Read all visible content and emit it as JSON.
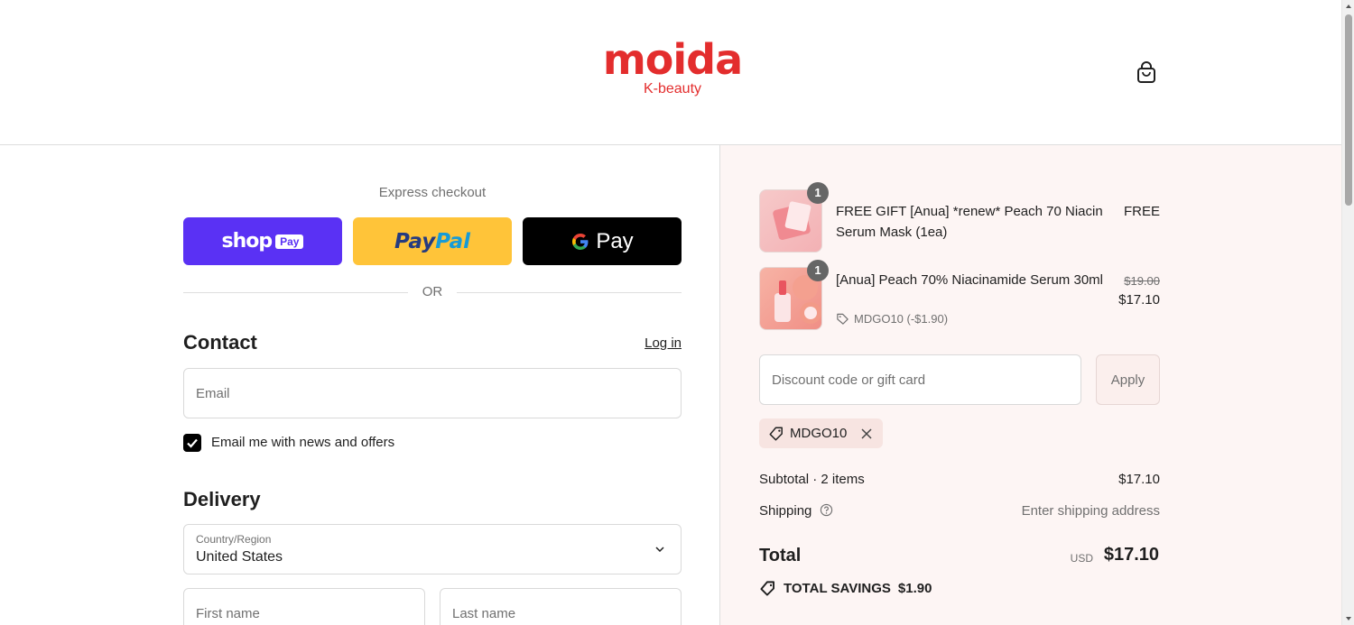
{
  "brand": {
    "name": "moida",
    "tagline": "K-beauty"
  },
  "header": {
    "cart_icon": "shopping-bag-icon"
  },
  "express": {
    "label": "Express checkout",
    "shop_pay": {
      "brand": "shop",
      "badge": "Pay",
      "color": "#5a31f4"
    },
    "paypal": {
      "part1": "Pay",
      "part2": "Pal",
      "color": "#ffc439"
    },
    "gpay": {
      "text": "Pay",
      "color": "#000000"
    },
    "or": "OR"
  },
  "contact": {
    "title": "Contact",
    "login": "Log in",
    "email_placeholder": "Email",
    "news_checkbox_checked": true,
    "news_label": "Email me with news and offers"
  },
  "delivery": {
    "title": "Delivery",
    "country_label": "Country/Region",
    "country_value": "United States",
    "first_name_placeholder": "First name",
    "last_name_placeholder": "Last name"
  },
  "summary": {
    "items": [
      {
        "qty": "1",
        "name": "FREE GIFT [Anua] *renew* Peach 70 Niacin Serum Mask (1ea)",
        "price": "FREE",
        "original_price": "",
        "discount": ""
      },
      {
        "qty": "1",
        "name": "[Anua] Peach 70% Niacinamide Serum 30ml",
        "price": "$17.10",
        "original_price": "$19.00",
        "discount": "MDGO10 (-$1.90)"
      }
    ],
    "discount_placeholder": "Discount code or gift card",
    "apply_label": "Apply",
    "applied_code": "MDGO10",
    "subtotal_label": "Subtotal · 2 items",
    "subtotal_value": "$17.10",
    "shipping_label": "Shipping",
    "shipping_value": "Enter shipping address",
    "total_label": "Total",
    "total_currency": "USD",
    "total_value": "$17.10",
    "savings_label": "TOTAL SAVINGS",
    "savings_value": "$1.90"
  }
}
